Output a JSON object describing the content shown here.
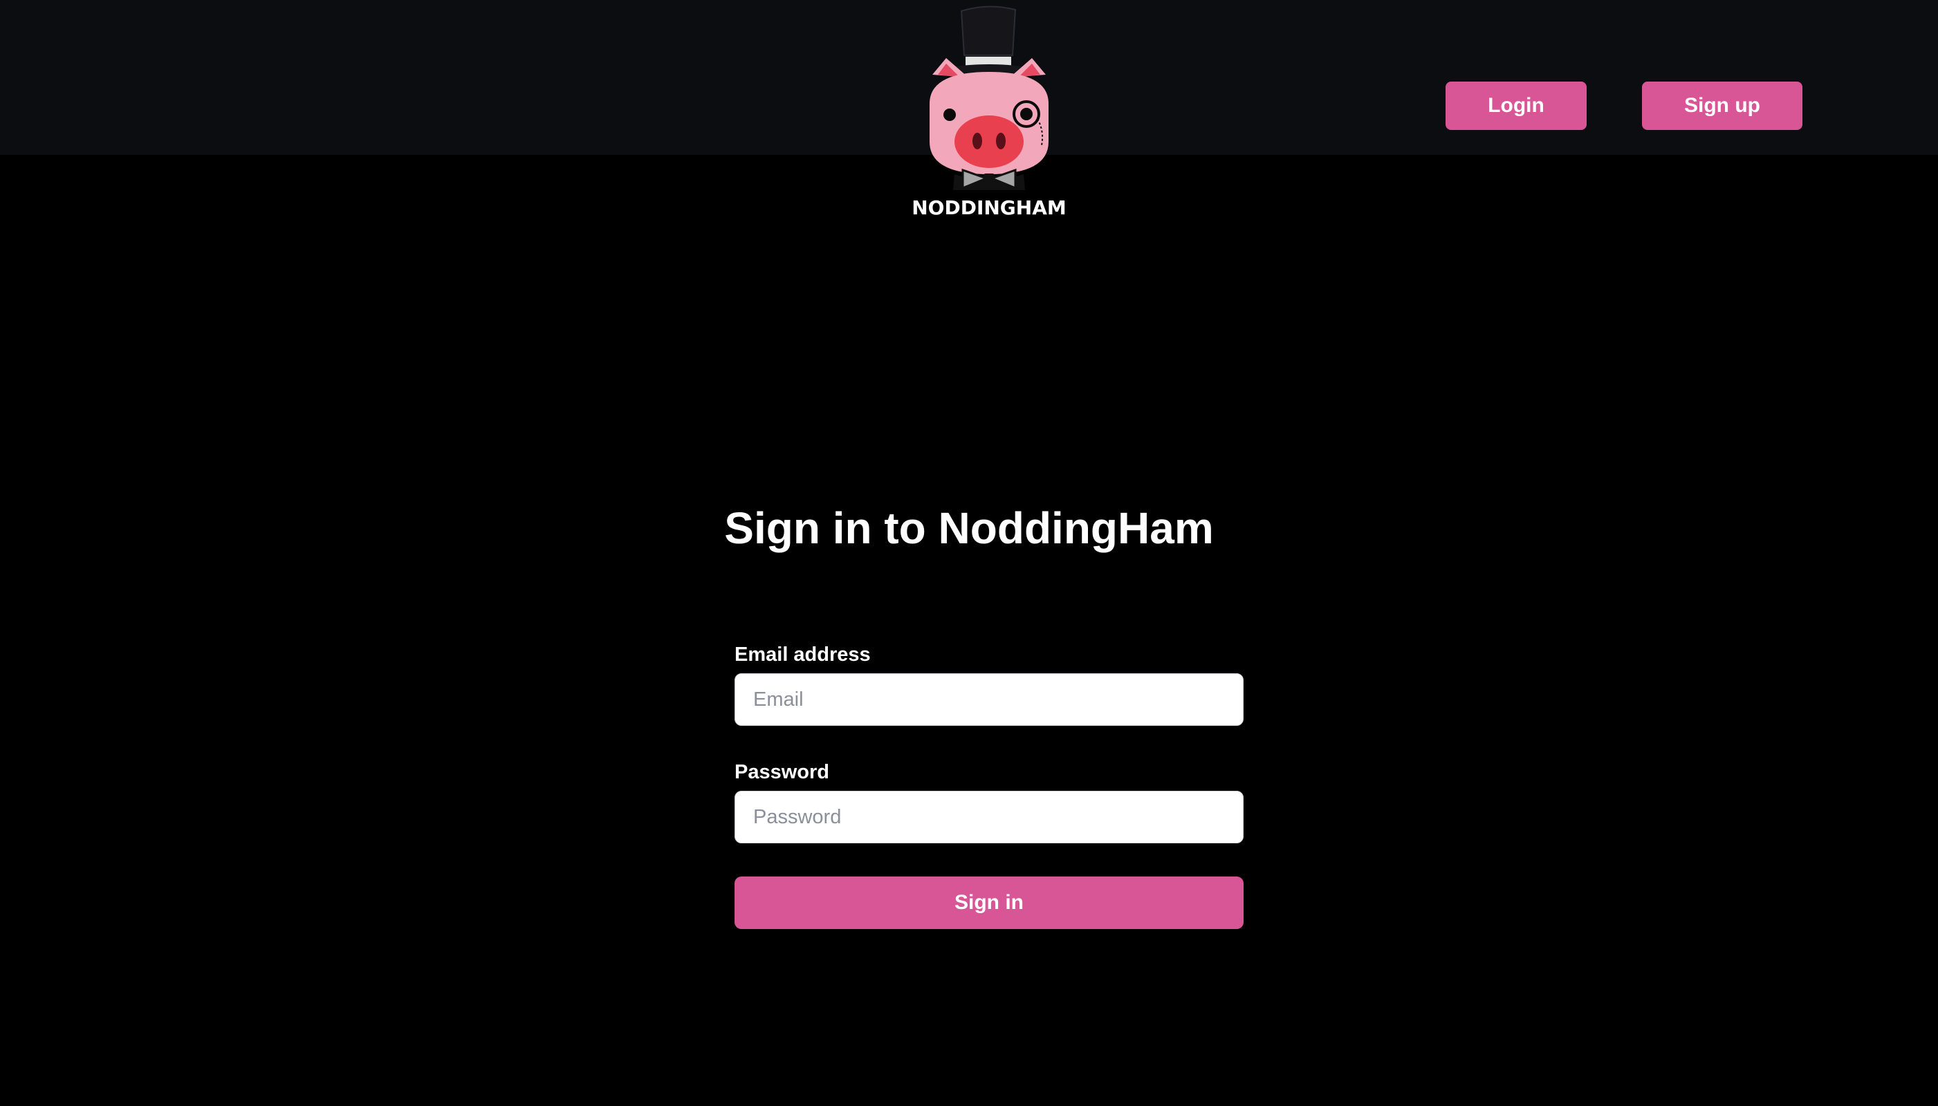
{
  "header": {
    "logo": {
      "icon": "top-hat-pig-mascot-logo",
      "wordmark": "NODDINGHAM"
    },
    "login_label": "Login",
    "signup_label": "Sign up"
  },
  "main": {
    "title": "Sign in to NoddingHam",
    "email": {
      "label": "Email address",
      "placeholder": "Email",
      "value": ""
    },
    "password": {
      "label": "Password",
      "placeholder": "Password",
      "value": ""
    },
    "submit_label": "Sign in"
  },
  "colors": {
    "background": "#000000",
    "header_background": "#0c0d10",
    "accent": "#d85695",
    "text": "#ffffff"
  }
}
